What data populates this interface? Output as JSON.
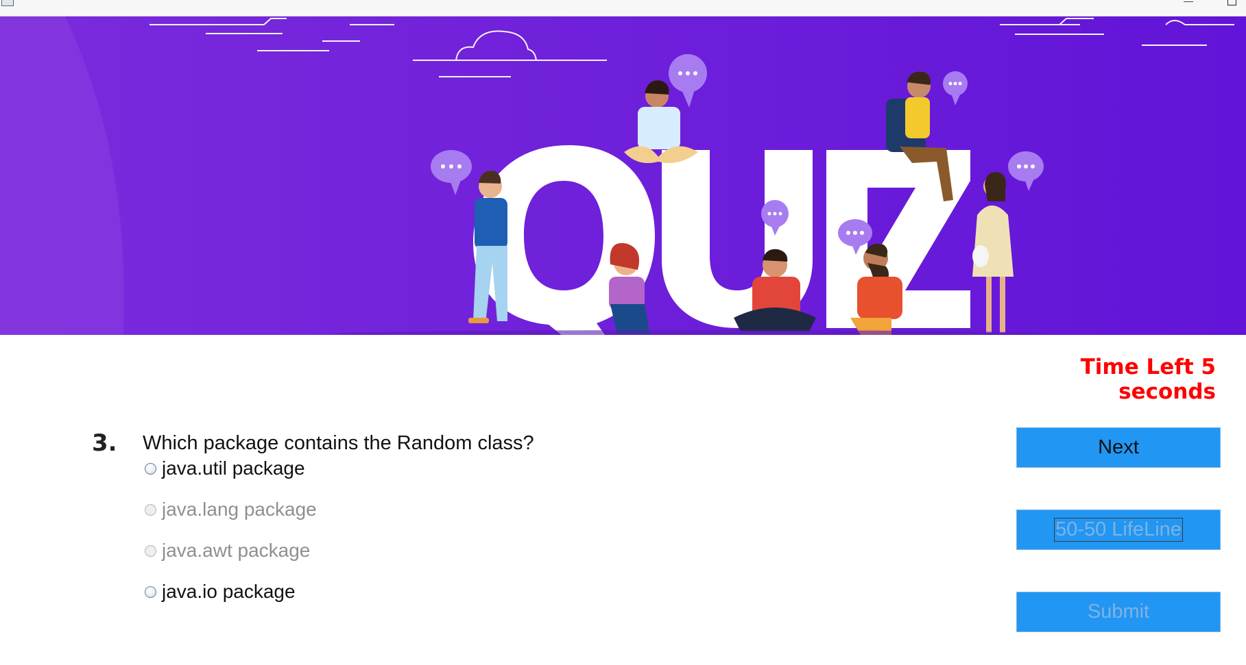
{
  "titlebar": {
    "app_icon": "app-icon",
    "minimize_icon": "minimize-icon",
    "maximize_icon": "maximize-icon"
  },
  "banner": {
    "word": "QUIZ",
    "gradient_colors": [
      "#7b2bdc",
      "#6214d8"
    ],
    "bubble_color": "#a77cf0"
  },
  "timer": {
    "text": "Time Left 5 seconds",
    "color": "#ff0000"
  },
  "question": {
    "number": "3.",
    "text": "Which package contains the Random class?",
    "options": [
      {
        "label": "java.util package",
        "enabled": true,
        "selected": false
      },
      {
        "label": "java.lang package",
        "enabled": false,
        "selected": false
      },
      {
        "label": "java.awt package",
        "enabled": false,
        "selected": false
      },
      {
        "label": "java.io package",
        "enabled": true,
        "selected": false
      }
    ]
  },
  "buttons": {
    "next": "Next",
    "lifeline": "50-50 LifeLine",
    "submit": "Submit",
    "color": "#2196f3"
  }
}
